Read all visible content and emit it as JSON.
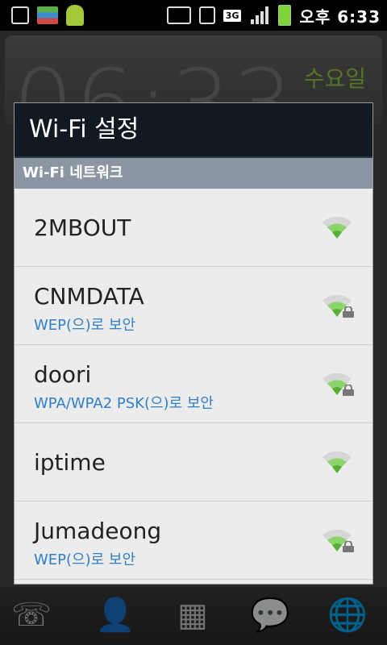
{
  "statusbar": {
    "time": "오후 6:33",
    "network_badge": "3G",
    "icons": [
      "download-icon",
      "app-grid-icon",
      "android-icon",
      "gamepad-icon",
      "vibrate-icon",
      "3g-data-icon",
      "signal-icon",
      "battery-icon"
    ]
  },
  "home": {
    "clock": "06:33",
    "day": "수요일"
  },
  "dialog": {
    "title": "Wi-Fi 설정",
    "section": "Wi-Fi 네트워크",
    "networks": [
      {
        "ssid": "2MBOUT",
        "security": "",
        "secured": false
      },
      {
        "ssid": "CNMDATA",
        "security": "WEP(으)로 보안",
        "secured": true
      },
      {
        "ssid": "doori",
        "security": "WPA/WPA2 PSK(으)로 보안",
        "secured": true
      },
      {
        "ssid": "iptime",
        "security": "",
        "secured": false
      },
      {
        "ssid": "Jumadeong",
        "security": "WEP(으)로 보안",
        "secured": true
      }
    ]
  },
  "colors": {
    "accent_green": "#9bd14c",
    "security_text": "#2f7fc7",
    "title_bg": "#121a21",
    "section_bg": "#8c96a2"
  }
}
